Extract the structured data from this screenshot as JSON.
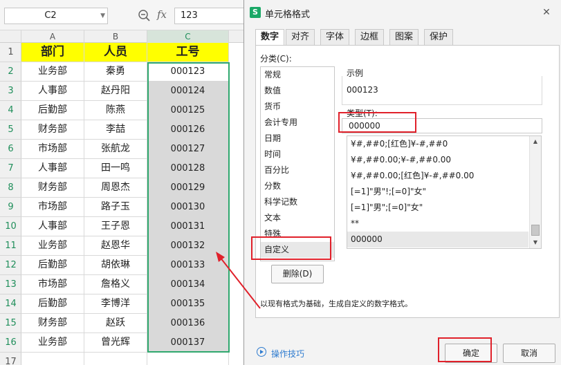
{
  "formula_bar": {
    "name_box": "C2",
    "fx": "fx",
    "value": "123"
  },
  "columns": [
    "A",
    "B",
    "C"
  ],
  "rows": [
    "1",
    "2",
    "3",
    "4",
    "5",
    "6",
    "7",
    "8",
    "9",
    "10",
    "11",
    "12",
    "13",
    "14",
    "15",
    "16",
    "17"
  ],
  "table": {
    "headers": [
      "部门",
      "人员",
      "工号"
    ],
    "rows": [
      [
        "业务部",
        "秦勇",
        "000123"
      ],
      [
        "人事部",
        "赵丹阳",
        "000124"
      ],
      [
        "后勤部",
        "陈燕",
        "000125"
      ],
      [
        "财务部",
        "李喆",
        "000126"
      ],
      [
        "市场部",
        "张航龙",
        "000127"
      ],
      [
        "人事部",
        "田一鸣",
        "000128"
      ],
      [
        "财务部",
        "周恩杰",
        "000129"
      ],
      [
        "市场部",
        "路子玉",
        "000130"
      ],
      [
        "人事部",
        "王子恩",
        "000131"
      ],
      [
        "业务部",
        "赵恩华",
        "000132"
      ],
      [
        "后勤部",
        "胡依琳",
        "000133"
      ],
      [
        "市场部",
        "詹格义",
        "000134"
      ],
      [
        "后勤部",
        "李博洋",
        "000135"
      ],
      [
        "财务部",
        "赵跃",
        "000136"
      ],
      [
        "业务部",
        "曾光辉",
        "000137"
      ]
    ]
  },
  "dialog": {
    "app_icon": "S",
    "title": "单元格格式",
    "close": "✕",
    "tabs": [
      "数字",
      "对齐",
      "字体",
      "边框",
      "图案",
      "保护"
    ],
    "category_label": "分类(C):",
    "categories": [
      "常规",
      "数值",
      "货币",
      "会计专用",
      "日期",
      "时间",
      "百分比",
      "分数",
      "科学记数",
      "文本",
      "特殊",
      "自定义"
    ],
    "selected_category": "自定义",
    "sample_label": "示例",
    "sample_value": "000123",
    "type_label": "类型(T):",
    "type_value": "000000",
    "formats": [
      "¥#,##0;[红色]¥-#,##0",
      "¥#,##0.00;¥-#,##0.00",
      "¥#,##0.00;[红色]¥-#,##0.00",
      "[=1]\"男\"!;[=0]\"女\"",
      "[=1]\"男\";[=0]\"女\"",
      "**",
      "000000"
    ],
    "delete_button": "删除(D)",
    "hint": "以现有格式为基础，生成自定义的数字格式。",
    "tips_link": "操作技巧",
    "ok_button": "确定",
    "cancel_button": "取消"
  },
  "colors": {
    "header_fill": "#ffff00",
    "selection_border": "#2fa86e",
    "annotation_red": "#e0202a",
    "link_blue": "#2e7bcf"
  }
}
